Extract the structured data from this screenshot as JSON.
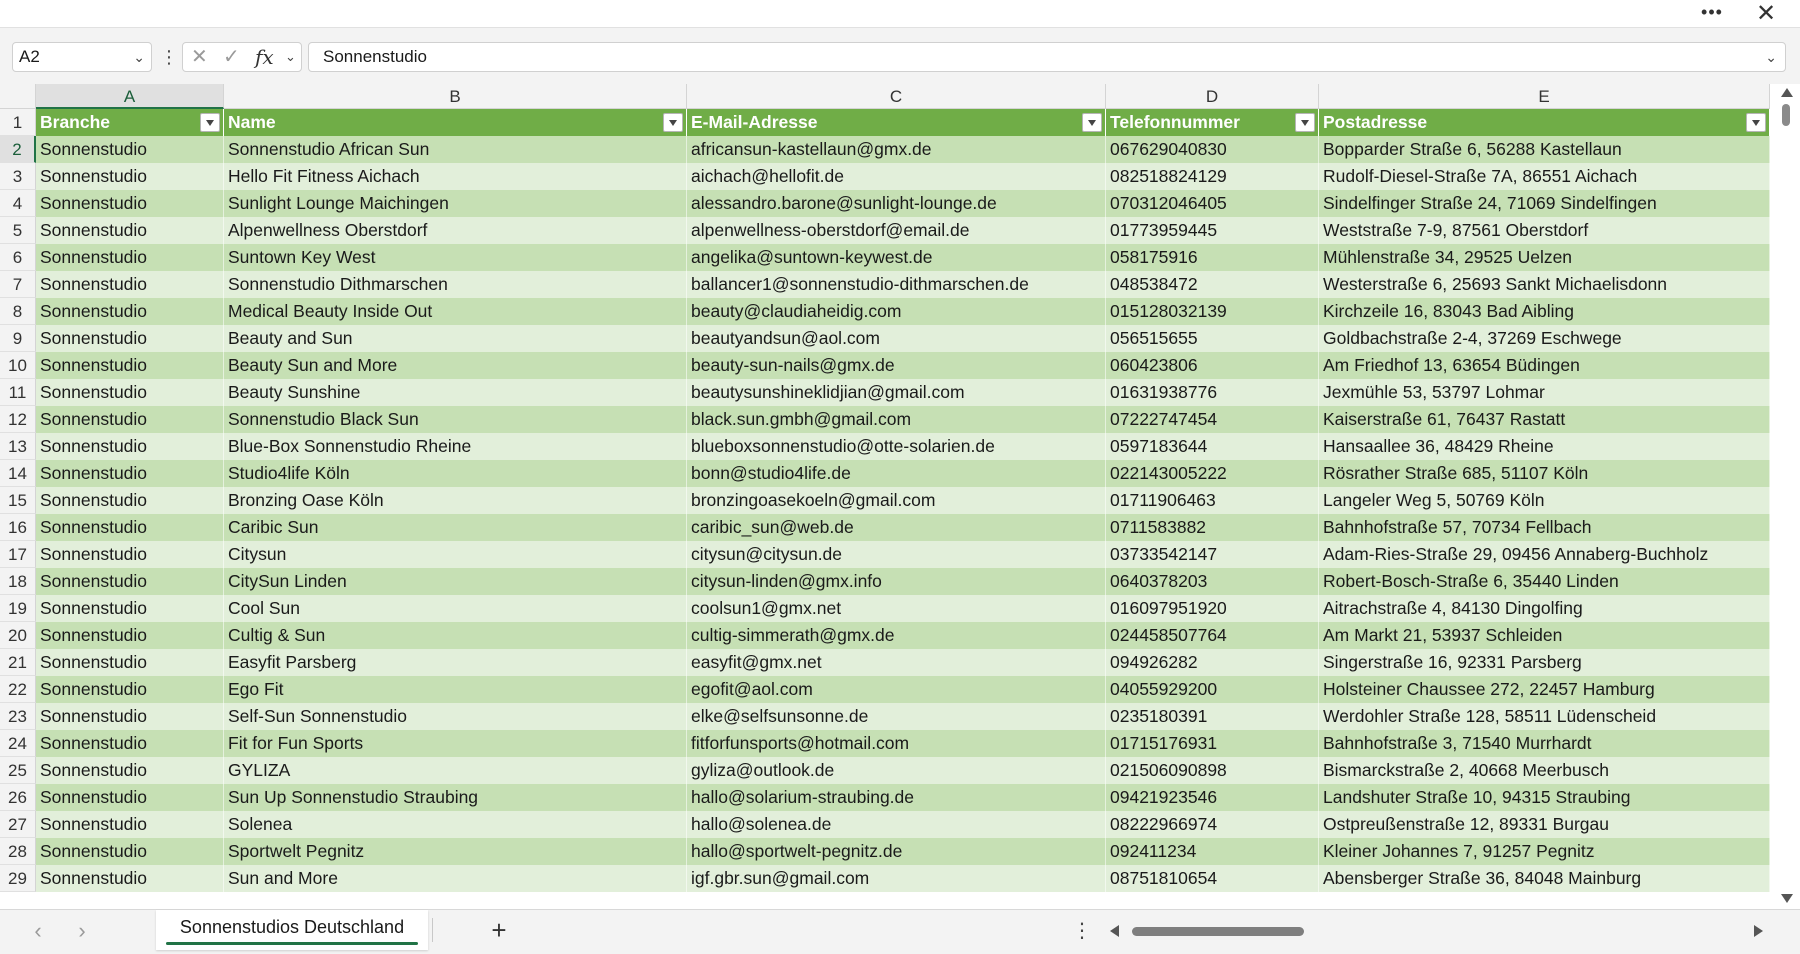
{
  "toolbar": {
    "more_label": "•••",
    "close_label": "✕"
  },
  "formula_bar": {
    "name_box": "A2",
    "fx_label": "fx",
    "formula_value": "Sonnenstudio"
  },
  "columns": [
    "A",
    "B",
    "C",
    "D",
    "E"
  ],
  "selected_column": "A",
  "header_row": [
    "Branche",
    "Name",
    "E-Mail-Adresse",
    "Telefonnummer",
    "Postadresse"
  ],
  "rows": [
    {
      "n": "2",
      "cells": [
        "Sonnenstudio",
        "Sonnenstudio African Sun",
        "africansun-kastellaun@gmx.de",
        "067629040830",
        "Bopparder Straße 6, 56288 Kastellaun"
      ]
    },
    {
      "n": "3",
      "cells": [
        "Sonnenstudio",
        "Hello Fit Fitness Aichach",
        "aichach@hellofit.de",
        "082518824129",
        "Rudolf-Diesel-Straße 7A, 86551 Aichach"
      ]
    },
    {
      "n": "4",
      "cells": [
        "Sonnenstudio",
        "Sunlight Lounge Maichingen",
        "alessandro.barone@sunlight-lounge.de",
        "070312046405",
        "Sindelfinger Straße 24, 71069 Sindelfingen"
      ]
    },
    {
      "n": "5",
      "cells": [
        "Sonnenstudio",
        "Alpenwellness Oberstdorf",
        "alpenwellness-oberstdorf@email.de",
        "01773959445",
        "Weststraße 7-9, 87561 Oberstdorf"
      ]
    },
    {
      "n": "6",
      "cells": [
        "Sonnenstudio",
        "Suntown Key West",
        "angelika@suntown-keywest.de",
        "058175916",
        "Mühlenstraße 34, 29525 Uelzen"
      ]
    },
    {
      "n": "7",
      "cells": [
        "Sonnenstudio",
        "Sonnenstudio Dithmarschen",
        "ballancer1@sonnenstudio-dithmarschen.de",
        "048538472",
        "Westerstraße 6, 25693 Sankt Michaelisdonn"
      ]
    },
    {
      "n": "8",
      "cells": [
        "Sonnenstudio",
        "Medical Beauty Inside Out",
        "beauty@claudiaheidig.com",
        "015128032139",
        "Kirchzeile 16, 83043 Bad Aibling"
      ]
    },
    {
      "n": "9",
      "cells": [
        "Sonnenstudio",
        "Beauty and Sun",
        "beautyandsun@aol.com",
        "056515655",
        "Goldbachstraße 2-4, 37269 Eschwege"
      ]
    },
    {
      "n": "10",
      "cells": [
        "Sonnenstudio",
        "Beauty Sun and More",
        "beauty-sun-nails@gmx.de",
        "060423806",
        "Am Friedhof 13, 63654 Büdingen"
      ]
    },
    {
      "n": "11",
      "cells": [
        "Sonnenstudio",
        "Beauty Sunshine",
        "beautysunshineklidjian@gmail.com",
        "01631938776",
        "Jexmühle 53, 53797 Lohmar"
      ]
    },
    {
      "n": "12",
      "cells": [
        "Sonnenstudio",
        "Sonnenstudio Black Sun",
        "black.sun.gmbh@gmail.com",
        "07222747454",
        "Kaiserstraße 61, 76437 Rastatt"
      ]
    },
    {
      "n": "13",
      "cells": [
        "Sonnenstudio",
        "Blue-Box Sonnenstudio Rheine",
        "blueboxsonnenstudio@otte-solarien.de",
        "0597183644",
        "Hansaallee 36, 48429 Rheine"
      ]
    },
    {
      "n": "14",
      "cells": [
        "Sonnenstudio",
        "Studio4life Köln",
        "bonn@studio4life.de",
        "022143005222",
        "Rösrather Straße 685, 51107 Köln"
      ]
    },
    {
      "n": "15",
      "cells": [
        "Sonnenstudio",
        "Bronzing Oase Köln",
        "bronzingoasekoeln@gmail.com",
        "01711906463",
        "Langeler Weg 5, 50769 Köln"
      ]
    },
    {
      "n": "16",
      "cells": [
        "Sonnenstudio",
        "Caribic Sun",
        "caribic_sun@web.de",
        "0711583882",
        "Bahnhofstraße 57, 70734 Fellbach"
      ]
    },
    {
      "n": "17",
      "cells": [
        "Sonnenstudio",
        "Citysun",
        "citysun@citysun.de",
        "03733542147",
        "Adam-Ries-Straße 29, 09456 Annaberg-Buchholz"
      ]
    },
    {
      "n": "18",
      "cells": [
        "Sonnenstudio",
        "CitySun Linden",
        "citysun-linden@gmx.info",
        "0640378203",
        "Robert-Bosch-Straße 6, 35440 Linden"
      ]
    },
    {
      "n": "19",
      "cells": [
        "Sonnenstudio",
        "Cool Sun",
        "coolsun1@gmx.net",
        "016097951920",
        "Aitrachstraße 4, 84130 Dingolfing"
      ]
    },
    {
      "n": "20",
      "cells": [
        "Sonnenstudio",
        "Cultig & Sun",
        "cultig-simmerath@gmx.de",
        "024458507764",
        "Am Markt 21, 53937 Schleiden"
      ]
    },
    {
      "n": "21",
      "cells": [
        "Sonnenstudio",
        "Easyfit Parsberg",
        "easyfit@gmx.net",
        "094926282",
        "Singerstraße 16, 92331 Parsberg"
      ]
    },
    {
      "n": "22",
      "cells": [
        "Sonnenstudio",
        "Ego Fit",
        "egofit@aol.com",
        "04055929200",
        "Holsteiner Chaussee 272, 22457 Hamburg"
      ]
    },
    {
      "n": "23",
      "cells": [
        "Sonnenstudio",
        "Self-Sun Sonnenstudio",
        "elke@selfsunsonne.de",
        "0235180391",
        "Werdohler Straße 128, 58511 Lüdenscheid"
      ]
    },
    {
      "n": "24",
      "cells": [
        "Sonnenstudio",
        "Fit for Fun Sports",
        "fitforfunsports@hotmail.com",
        "01715176931",
        "Bahnhofstraße 3, 71540 Murrhardt"
      ]
    },
    {
      "n": "25",
      "cells": [
        "Sonnenstudio",
        "GYLIZA",
        "gyliza@outlook.de",
        "021506090898",
        "Bismarckstraße 2, 40668 Meerbusch"
      ]
    },
    {
      "n": "26",
      "cells": [
        "Sonnenstudio",
        "Sun Up Sonnenstudio Straubing",
        "hallo@solarium-straubing.de",
        "09421923546",
        "Landshuter Straße 10, 94315 Straubing"
      ]
    },
    {
      "n": "27",
      "cells": [
        "Sonnenstudio",
        "Solenea",
        "hallo@solenea.de",
        "08222966974",
        "Ostpreußenstraße 12, 89331 Burgau"
      ]
    },
    {
      "n": "28",
      "cells": [
        "Sonnenstudio",
        "Sportwelt Pegnitz",
        "hallo@sportwelt-pegnitz.de",
        "092411234",
        "Kleiner Johannes 7, 91257 Pegnitz"
      ]
    },
    {
      "n": "29",
      "cells": [
        "Sonnenstudio",
        "Sun and More",
        "igf.gbr.sun@gmail.com",
        "08751810654",
        "Abensberger Straße 36, 84048 Mainburg"
      ]
    }
  ],
  "sheet_tab": {
    "name": "Sonnenstudios Deutschland"
  },
  "colors": {
    "header": "#70ad47",
    "band_dark": "#c6e0b4",
    "band_light": "#e2efda",
    "accent": "#217346"
  },
  "icons": {
    "add_sheet": "plus-icon",
    "prev_sheet": "chevron-left-icon",
    "next_sheet": "chevron-right-icon"
  }
}
